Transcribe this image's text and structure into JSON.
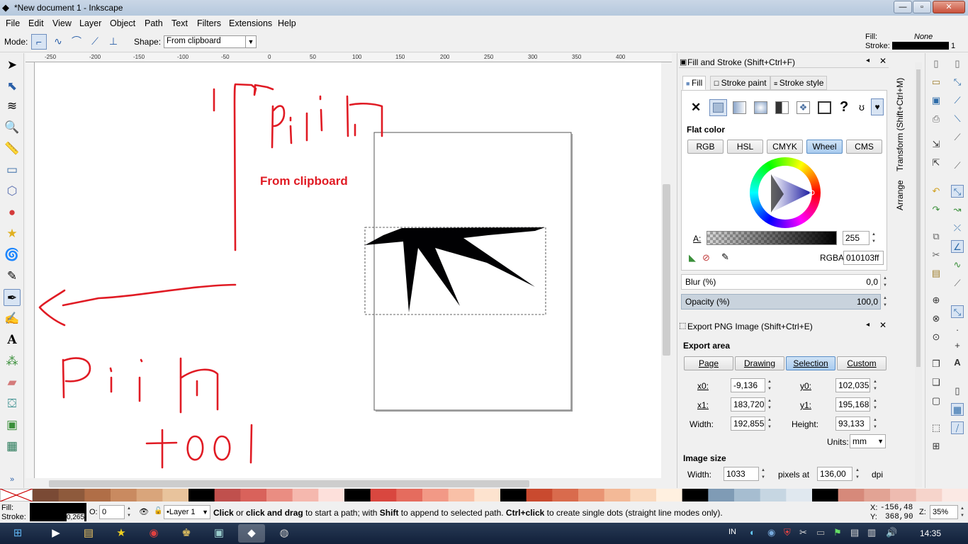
{
  "window": {
    "title": "*New document 1 - Inkscape"
  },
  "menu": [
    "File",
    "Edit",
    "View",
    "Layer",
    "Object",
    "Path",
    "Text",
    "Filters",
    "Extensions",
    "Help"
  ],
  "tool_controls": {
    "mode_label": "Mode:",
    "shape_label": "Shape:",
    "shape_value": "From clipboard",
    "fill_label": "Fill:",
    "fill_value": "None",
    "stroke_label": "Stroke:",
    "stroke_width": "1"
  },
  "ruler_labels": [
    "-250",
    "-200",
    "-150",
    "-100",
    "-50",
    "0",
    "50",
    "100",
    "150",
    "200",
    "250",
    "300",
    "350",
    "400"
  ],
  "canvas": {
    "annotation_text": "From clipboard",
    "ink_color": "#e01b24"
  },
  "fill_stroke": {
    "title": "Fill and Stroke (Shift+Ctrl+F)",
    "tabs": [
      "Fill",
      "Stroke paint",
      "Stroke style"
    ],
    "mode_label": "Flat color",
    "color_modes": [
      "RGB",
      "HSL",
      "CMYK",
      "Wheel",
      "CMS"
    ],
    "active_color_mode": "Wheel",
    "alpha_label": "A:",
    "alpha_value": "255",
    "rgba_label": "RGBA:",
    "rgba_value": "010103ff",
    "blur_label": "Blur (%)",
    "blur_value": "0,0",
    "opacity_label": "Opacity (%)",
    "opacity_value": "100,0"
  },
  "export": {
    "title": "Export PNG Image (Shift+Ctrl+E)",
    "area_label": "Export area",
    "area_buttons": [
      "Page",
      "Drawing",
      "Selection",
      "Custom"
    ],
    "active_area": "Selection",
    "x0_label": "x0:",
    "x0": "-9,136",
    "y0_label": "y0:",
    "y0": "102,035",
    "x1_label": "x1:",
    "x1": "183,720",
    "y1_label": "y1:",
    "y1": "195,168",
    "width_label": "Width:",
    "width": "192,855",
    "height_label": "Height:",
    "height": "93,133",
    "units_label": "Units:",
    "units": "mm",
    "image_size_label": "Image size",
    "img_width_label": "Width:",
    "img_width": "1033",
    "pixels_at_label": "pixels at",
    "dpi_value": "136,00",
    "dpi_label": "dpi"
  },
  "side_tabs": {
    "transform": "Transform (Shift+Ctrl+M)",
    "arrange": "Arrange"
  },
  "palette_colors": [
    "#7a4a35",
    "#8e5a3c",
    "#b06e47",
    "#c98a60",
    "#d9a57b",
    "#e8c39c",
    "#000000",
    "#c0504d",
    "#d9625b",
    "#ea8d82",
    "#f5b8ae",
    "#fde0db",
    "#000000",
    "#d9473f",
    "#e56c5e",
    "#f29986",
    "#f9c0a7",
    "#fde3cf",
    "#000000",
    "#c94a2f",
    "#d96b4d",
    "#e99473",
    "#f3b997",
    "#fad8bd",
    "#fff0e0",
    "#000000",
    "#7f9bb5",
    "#a6bdd0",
    "#c6d6e2",
    "#e0e8ef",
    "#000000",
    "#d6897a",
    "#e2a394",
    "#eebbb0",
    "#f6d4cb",
    "#fbe9e4"
  ],
  "status": {
    "fill_label": "Fill:",
    "stroke_label": "Stroke:",
    "stroke_value": "0,265",
    "opacity_label": "O:",
    "opacity_value": "0",
    "layer": "•Layer 1",
    "message_bold1": "Click",
    "message_part1": " or ",
    "message_bold2": "click and drag",
    "message_part2": " to start a path; with ",
    "message_bold3": "Shift",
    "message_part3": " to append to selected path. ",
    "message_bold4": "Ctrl+click",
    "message_part4": " to create single dots (straight line modes only).",
    "x_label": "X:",
    "x_value": "-156,48",
    "y_label": "Y:",
    "y_value": "368,90",
    "zoom_label": "Z:",
    "zoom_value": "35%"
  },
  "taskbar": {
    "input_lang": "IN",
    "clock": "14:35"
  }
}
